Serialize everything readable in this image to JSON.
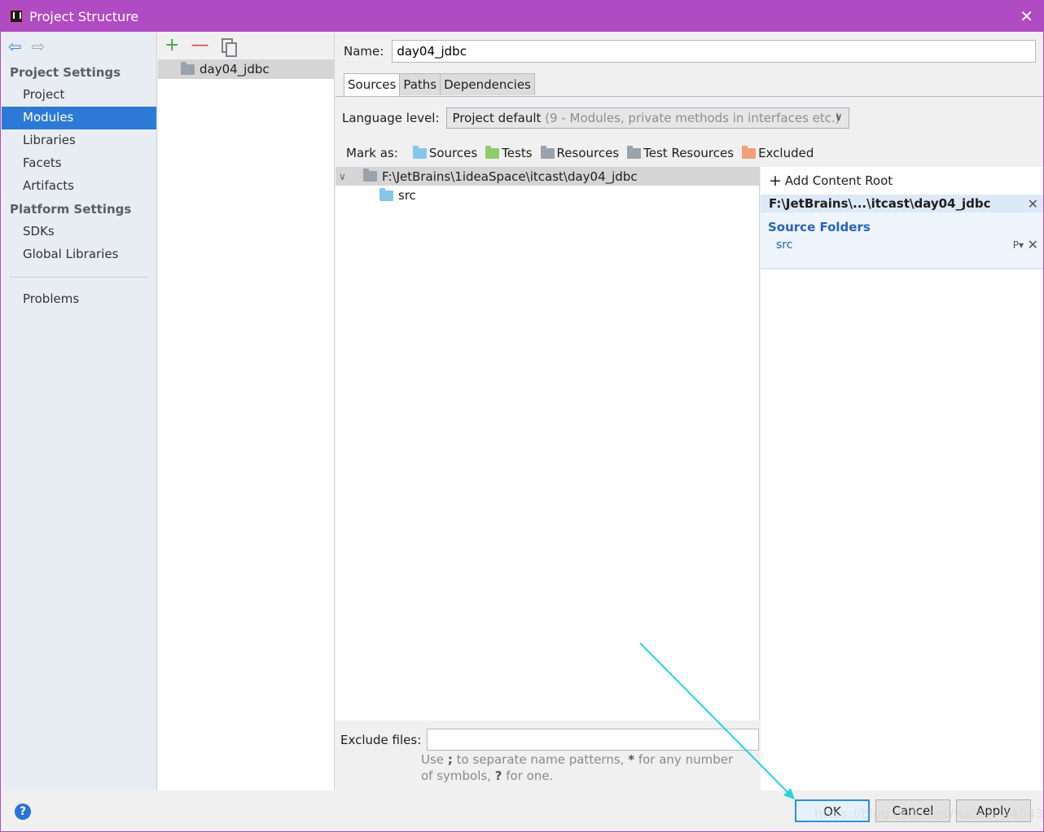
{
  "window": {
    "title": "Project Structure"
  },
  "nav": {
    "group_project": "Project Settings",
    "project_items": [
      "Project",
      "Modules",
      "Libraries",
      "Facets",
      "Artifacts"
    ],
    "group_platform": "Platform Settings",
    "platform_items": [
      "SDKs",
      "Global Libraries"
    ],
    "problems": "Problems"
  },
  "modules": {
    "items": [
      "day04_jdbc"
    ]
  },
  "main": {
    "name_label": "Name:",
    "name_value": "day04_jdbc",
    "tabs": [
      "Sources",
      "Paths",
      "Dependencies"
    ],
    "language_label": "Language level:",
    "language_value": "Project default",
    "language_hint": "(9 - Modules, private methods in interfaces etc.)",
    "mark_as_label": "Mark as:",
    "mark_items": [
      "Sources",
      "Tests",
      "Resources",
      "Test Resources",
      "Excluded"
    ],
    "tree_root": "F:\\JetBrains\\1ideaSpace\\itcast\\day04_jdbc",
    "tree_child": "src",
    "exclude_label": "Exclude files:",
    "exclude_value": "",
    "exclude_hint_1": "Use",
    "exclude_hint_semicolon": ";",
    "exclude_hint_2": "to separate name patterns,",
    "exclude_hint_star": "*",
    "exclude_hint_3": "for any number of symbols,",
    "exclude_hint_q": "?",
    "exclude_hint_4": "for one."
  },
  "roots": {
    "add_label": "Add Content Root",
    "root_path": "F:\\JetBrains\\...\\itcast\\day04_jdbc",
    "source_folders_title": "Source Folders",
    "source_folder": "src"
  },
  "buttons": {
    "ok": "OK",
    "cancel": "Cancel",
    "apply": "Apply"
  },
  "watermark": "https://blog.csdn.net/weixin_44043135",
  "colors": {
    "titlebar": "#b04bc3",
    "selection": "#2d7ad6",
    "annotation_arrow": "#27d6d9"
  }
}
